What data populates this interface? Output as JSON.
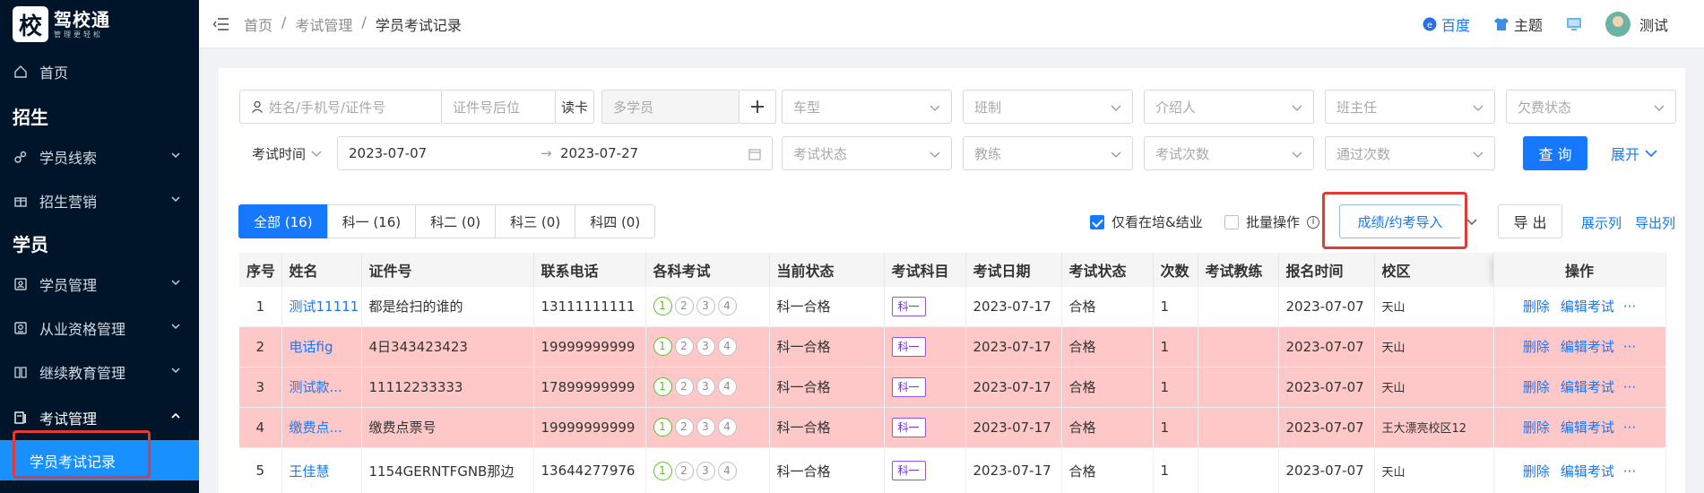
{
  "brand": {
    "logo_char": "校",
    "title": "驾校通",
    "subtitle": "管理更轻松"
  },
  "sidebar": {
    "home": "首页",
    "section_recruit": "招生",
    "leads": "学员线索",
    "marketing": "招生营销",
    "section_student": "学员",
    "student_mgmt": "学员管理",
    "qualification": "从业资格管理",
    "continuing_edu": "继续教育管理",
    "exam_mgmt": "考试管理",
    "exam_records": "学员考试记录"
  },
  "header": {
    "breadcrumb": [
      "首页",
      "考试管理",
      "学员考试记录"
    ],
    "baidu": "百度",
    "theme": "主题",
    "username": "测试"
  },
  "filters": {
    "search_placeholder": "姓名/手机号/证件号",
    "id_suffix_placeholder": "证件号后位",
    "read_card": "读卡",
    "multi_student": "多学员",
    "car_type": "车型",
    "class_type": "班制",
    "referrer": "介绍人",
    "head_teacher": "班主任",
    "arrears": "欠费状态",
    "date_type": "考试时间",
    "date_start": "2023-07-07",
    "date_end": "2023-07-27",
    "exam_status": "考试状态",
    "coach": "教练",
    "exam_count": "考试次数",
    "pass_count": "通过次数",
    "query": "查 询",
    "expand": "展开"
  },
  "tabs": [
    "全部 (16)",
    "科一 (16)",
    "科二 (0)",
    "科三 (0)",
    "科四 (0)"
  ],
  "toolbar": {
    "only_active": "仅看在培&结业",
    "batch": "批量操作",
    "import": "成绩/约考导入",
    "export": "导 出",
    "show_cols": "展示列",
    "export_cols": "导出列"
  },
  "table": {
    "columns": [
      "序号",
      "姓名",
      "证件号",
      "联系电话",
      "各科考试",
      "当前状态",
      "考试科目",
      "考试日期",
      "考试状态",
      "次数",
      "考试教练",
      "报名时间",
      "校区",
      "操作"
    ],
    "rows": [
      {
        "no": "1",
        "name": "测试11111",
        "id": "都是给扫的谁的",
        "phone": "13111111111",
        "status": "科一合格",
        "subject": "科一",
        "date": "2023-07-17",
        "exam_status": "合格",
        "times": "1",
        "coach": "",
        "signup": "2023-07-07",
        "campus": "天山",
        "highlight": false
      },
      {
        "no": "2",
        "name": "电话fig",
        "id": "4日343423423",
        "phone": "19999999999",
        "status": "科一合格",
        "subject": "科一",
        "date": "2023-07-17",
        "exam_status": "合格",
        "times": "1",
        "coach": "",
        "signup": "2023-07-07",
        "campus": "天山",
        "highlight": true
      },
      {
        "no": "3",
        "name": "测试款...",
        "id": "11112233333",
        "phone": "17899999999",
        "status": "科一合格",
        "subject": "科一",
        "date": "2023-07-17",
        "exam_status": "合格",
        "times": "1",
        "coach": "",
        "signup": "2023-07-07",
        "campus": "天山",
        "highlight": true
      },
      {
        "no": "4",
        "name": "缴费点...",
        "id": "缴费点票号",
        "phone": "19999999999",
        "status": "科一合格",
        "subject": "科一",
        "date": "2023-07-17",
        "exam_status": "合格",
        "times": "1",
        "coach": "",
        "signup": "2023-07-07",
        "campus": "王大漂亮校区12",
        "highlight": true
      },
      {
        "no": "5",
        "name": "王佳慧",
        "id": "1154GERNTFGNB那边",
        "phone": "13644277976",
        "status": "科一合格",
        "subject": "科一",
        "date": "2023-07-17",
        "exam_status": "合格",
        "times": "1",
        "coach": "",
        "signup": "2023-07-07",
        "campus": "天山",
        "highlight": false
      }
    ],
    "exam_circles": [
      "1",
      "2",
      "3",
      "4"
    ],
    "ops": {
      "delete": "删除",
      "edit": "编辑考试",
      "more": "···"
    }
  }
}
